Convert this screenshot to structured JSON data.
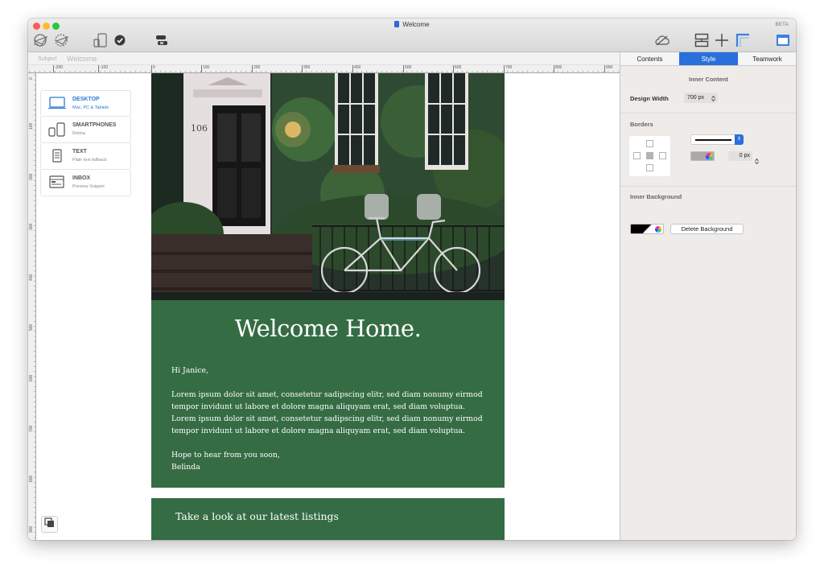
{
  "window": {
    "title": "Welcome",
    "badge": "BETA"
  },
  "toolbar": {
    "left_icons": [
      "preview-send-icon",
      "test-send-icon",
      "devices-icon",
      "check-icon",
      "link-icon"
    ],
    "right_icons": [
      "cloud-icon",
      "layout-icon",
      "move-icon",
      "margins-icon",
      "panel-toggle-icon"
    ]
  },
  "subject": {
    "label": "Subject",
    "value": "Welcome"
  },
  "ruler": {
    "h_labels": [
      "-200",
      "-100",
      "0",
      "100",
      "200",
      "300",
      "400",
      "500",
      "600",
      "700",
      "800",
      "900"
    ],
    "v_labels": [
      "0",
      "100",
      "200",
      "300",
      "400",
      "500",
      "600",
      "700",
      "800",
      "900"
    ]
  },
  "devices": [
    {
      "name": "DESKTOP",
      "sub": "Mac, PC & Tablets",
      "icon": "desktop-icon",
      "active": true
    },
    {
      "name": "SMARTPHONES",
      "sub": "Retina",
      "icon": "smartphones-icon",
      "active": false
    },
    {
      "name": "TEXT",
      "sub": "Plain text fallback",
      "icon": "text-doc-icon",
      "active": false
    },
    {
      "name": "INBOX",
      "sub": "Preview Snippet",
      "icon": "inbox-icon",
      "active": false
    }
  ],
  "email": {
    "hero_number": "106",
    "headline": "Welcome Home.",
    "greeting": "Hi Janice,",
    "body": "Lorem ipsum dolor sit amet, consetetur sadipscing elitr, sed diam nonumy eirmod tempor invidunt ut labore et dolore magna aliquyam erat, sed diam voluptua. Lorem ipsum dolor sit amet, consetetur sadipscing elitr, sed diam nonumy eirmod tempor invidunt ut labore et dolore magna aliquyam erat, sed diam voluptua.",
    "signoff": "Hope to hear from you soon,",
    "signature": "Belinda",
    "listings_title": "Take a look at our latest listings",
    "green": "#356c44"
  },
  "panel": {
    "tabs": [
      {
        "label": "Contents",
        "active": false
      },
      {
        "label": "Style",
        "active": true
      },
      {
        "label": "Teamwork",
        "active": false
      }
    ],
    "inner_content_title": "Inner Content",
    "design_width_label": "Design Width",
    "design_width_value": "700 px",
    "borders_title": "Borders",
    "border_px_value": "0 px",
    "inner_background_title": "Inner Background",
    "delete_background_label": "Delete Background",
    "accent": "#2a6fdb"
  }
}
